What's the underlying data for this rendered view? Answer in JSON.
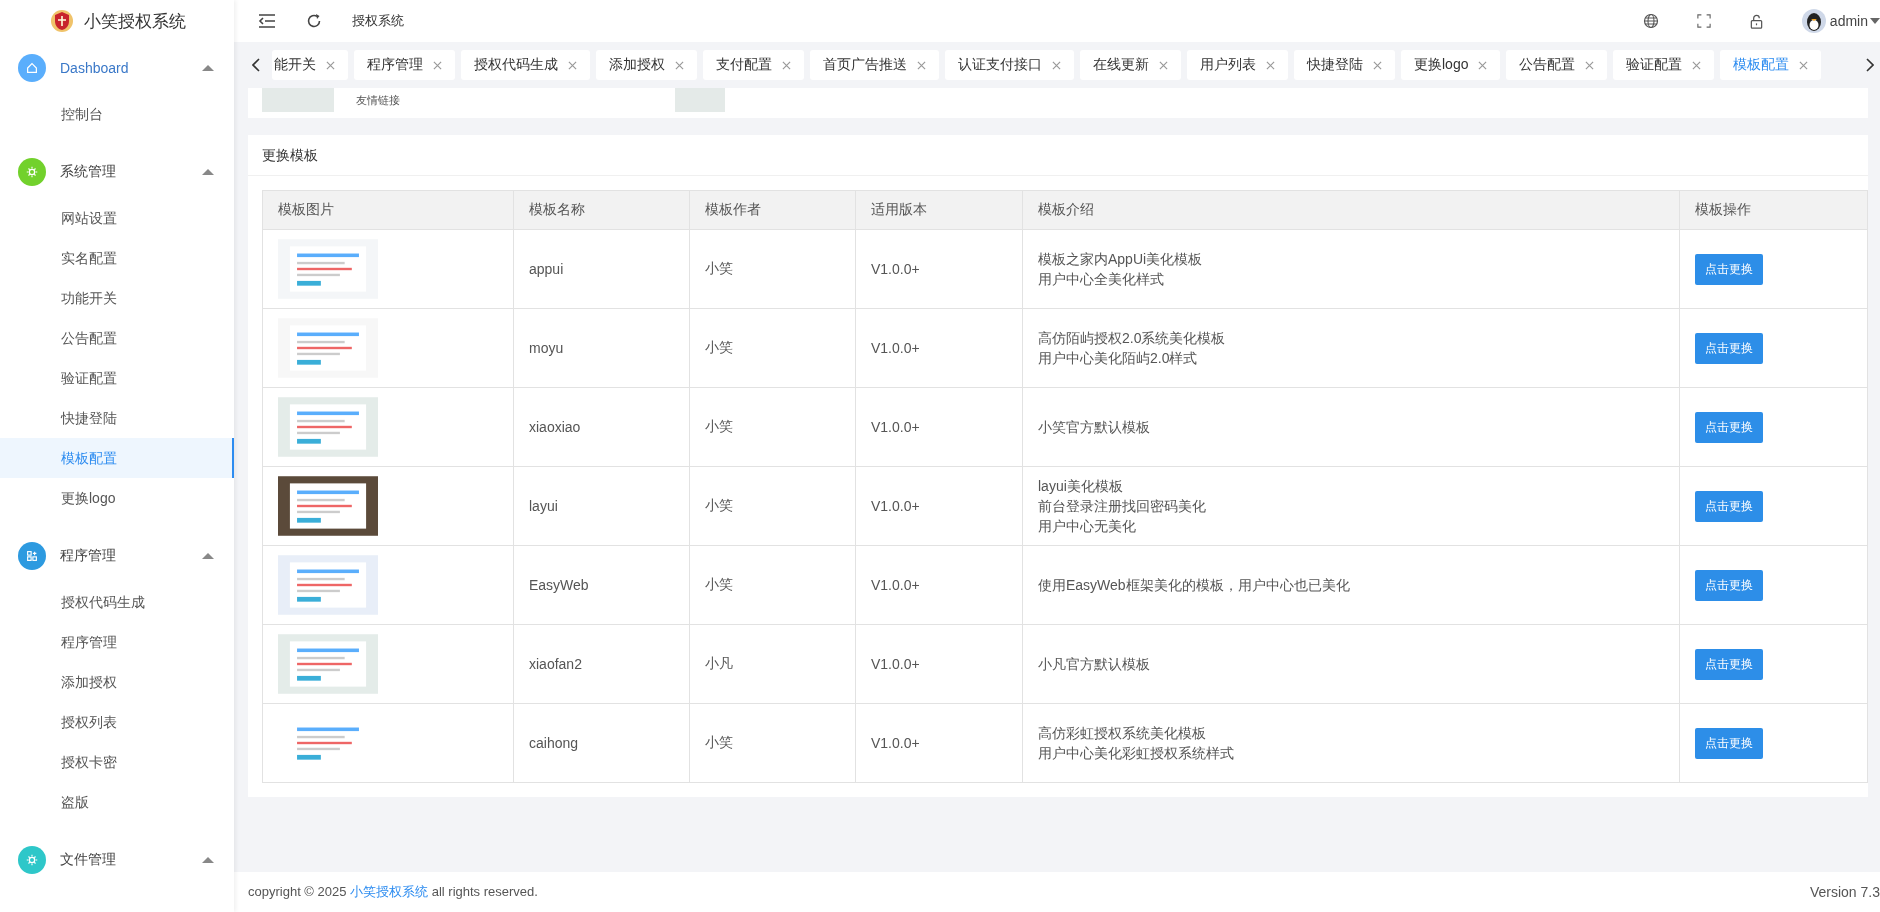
{
  "app": {
    "title": "小笑授权系统"
  },
  "header": {
    "breadcrumb": "授权系统",
    "user": "admin"
  },
  "sidebar": {
    "groups": [
      {
        "label": "Dashboard",
        "kind": "home",
        "color": "#5aaefc",
        "selected": true,
        "expanded": true,
        "items": [
          {
            "label": "控制台",
            "selected": false
          }
        ]
      },
      {
        "label": "系统管理",
        "kind": "gear",
        "color": "#72d12c",
        "selected": false,
        "expanded": true,
        "items": [
          {
            "label": "网站设置",
            "selected": false
          },
          {
            "label": "实名配置",
            "selected": false
          },
          {
            "label": "功能开关",
            "selected": false
          },
          {
            "label": "公告配置",
            "selected": false
          },
          {
            "label": "验证配置",
            "selected": false
          },
          {
            "label": "快捷登陆",
            "selected": false
          },
          {
            "label": "模板配置",
            "selected": true
          },
          {
            "label": "更换logo",
            "selected": false
          }
        ]
      },
      {
        "label": "程序管理",
        "kind": "app",
        "color": "#2d9ae0",
        "selected": false,
        "expanded": true,
        "items": [
          {
            "label": "授权代码生成",
            "selected": false
          },
          {
            "label": "程序管理",
            "selected": false
          },
          {
            "label": "添加授权",
            "selected": false
          },
          {
            "label": "授权列表",
            "selected": false
          },
          {
            "label": "授权卡密",
            "selected": false
          },
          {
            "label": "盗版",
            "selected": false
          }
        ]
      },
      {
        "label": "文件管理",
        "kind": "gear",
        "color": "#2ec7c9",
        "selected": false,
        "expanded": true
      }
    ]
  },
  "tabs": [
    {
      "label": "能开关",
      "selected": false
    },
    {
      "label": "程序管理",
      "selected": false
    },
    {
      "label": "授权代码生成",
      "selected": false
    },
    {
      "label": "添加授权",
      "selected": false
    },
    {
      "label": "支付配置",
      "selected": false
    },
    {
      "label": "首页广告推送",
      "selected": false
    },
    {
      "label": "认证支付接口",
      "selected": false
    },
    {
      "label": "在线更新",
      "selected": false
    },
    {
      "label": "用户列表",
      "selected": false
    },
    {
      "label": "快捷登陆",
      "selected": false
    },
    {
      "label": "更换logo",
      "selected": false
    },
    {
      "label": "公告配置",
      "selected": false
    },
    {
      "label": "验证配置",
      "selected": false
    },
    {
      "label": "模板配置",
      "selected": true
    }
  ],
  "top_card": {
    "text": "友情链接"
  },
  "template_card": {
    "title": "更换模板",
    "table": {
      "columns": [
        "模板图片",
        "模板名称",
        "模板作者",
        "适用版本",
        "模板介绍",
        "模板操作"
      ],
      "rows": [
        {
          "name": "appui",
          "author": "小笑",
          "version": "V1.0.0+",
          "description": [
            "模板之家内AppUi美化模板",
            "用户中心全美化样式"
          ],
          "action": "点击更换"
        },
        {
          "name": "moyu",
          "author": "小笑",
          "version": "V1.0.0+",
          "description": [
            "高仿陌屿授权2.0系统美化模板",
            "用户中心美化陌屿2.0样式"
          ],
          "action": "点击更换"
        },
        {
          "name": "xiaoxiao",
          "author": "小笑",
          "version": "V1.0.0+",
          "description": [
            "小笑官方默认模板"
          ],
          "action": "点击更换"
        },
        {
          "name": "layui",
          "author": "小笑",
          "version": "V1.0.0+",
          "description": [
            "layui美化模板",
            "前台登录注册找回密码美化",
            "用户中心无美化"
          ],
          "action": "点击更换"
        },
        {
          "name": "EasyWeb",
          "author": "小笑",
          "version": "V1.0.0+",
          "description": [
            "使用EasyWeb框架美化的模板，用户中心也已美化"
          ],
          "action": "点击更换"
        },
        {
          "name": "xiaofan2",
          "author": "小凡",
          "version": "V1.0.0+",
          "description": [
            "小凡官方默认模板"
          ],
          "action": "点击更换"
        },
        {
          "name": "caihong",
          "author": "小笑",
          "version": "V1.0.0+",
          "description": [
            "高仿彩虹授权系统美化模板",
            "用户中心美化彩虹授权系统样式"
          ],
          "action": "点击更换"
        }
      ]
    }
  },
  "footer": {
    "prefix": "copyright © 2025",
    "link": "小笑授权系统",
    "suffix": "all rights reserved.",
    "version": "Version 7.3"
  }
}
